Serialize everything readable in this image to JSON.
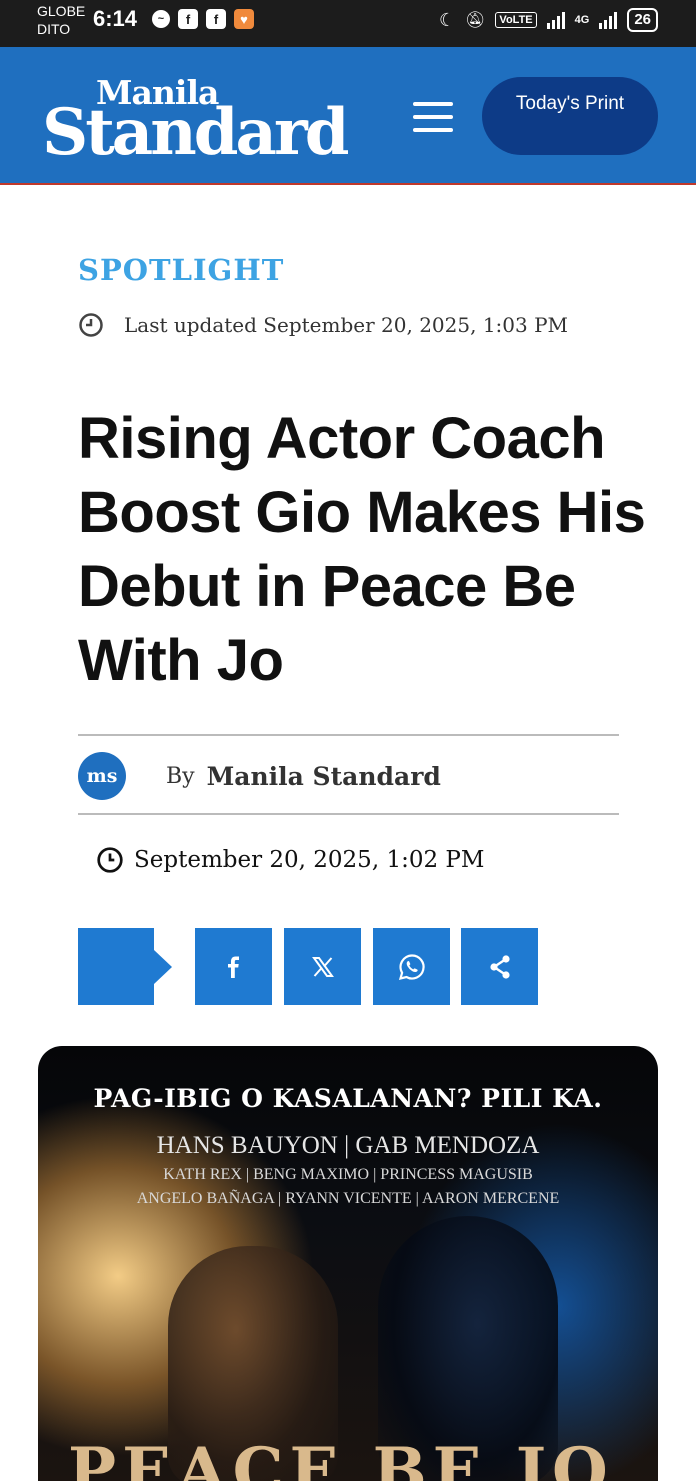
{
  "status_bar": {
    "carrier_1": "GLOBE",
    "carrier_2": "DITO",
    "time": "6:14",
    "network": "4G",
    "volte": "VoLTE",
    "battery": "26"
  },
  "header": {
    "logo_top": "Manila",
    "logo_bottom": "Standard",
    "print_button": "Today's Print"
  },
  "article": {
    "category": "SPOTLIGHT",
    "last_updated": "Last updated September 20, 2025, 1:03 PM",
    "headline": "Rising Actor Coach Boost Gio Makes His Debut in Peace Be With Jo",
    "author_avatar": "ms",
    "by_label": "By",
    "author": "Manila Standard",
    "published": "September 20, 2025, 1:02 PM"
  },
  "share": {
    "buttons": [
      "facebook-icon",
      "x-icon",
      "whatsapp-icon",
      "share-icon"
    ]
  },
  "poster": {
    "tagline": "PAG-IBIG O KASALANAN? PILI KA.",
    "leads": "HANS BAUYON | GAB MENDOZA",
    "cast_line_1": "KATH REX | BENG MAXIMO | PRINCESS MAGUSIB",
    "cast_line_2": "ANGELO BAÑAGA | RYANN VICENTE | AARON MERCENE",
    "title_fragment": "PEACE BE JO"
  },
  "colors": {
    "brand_blue": "#1f6fbf",
    "print_button": "#0d3b87",
    "category": "#3da3e3",
    "share_button": "#1f7ad1"
  }
}
